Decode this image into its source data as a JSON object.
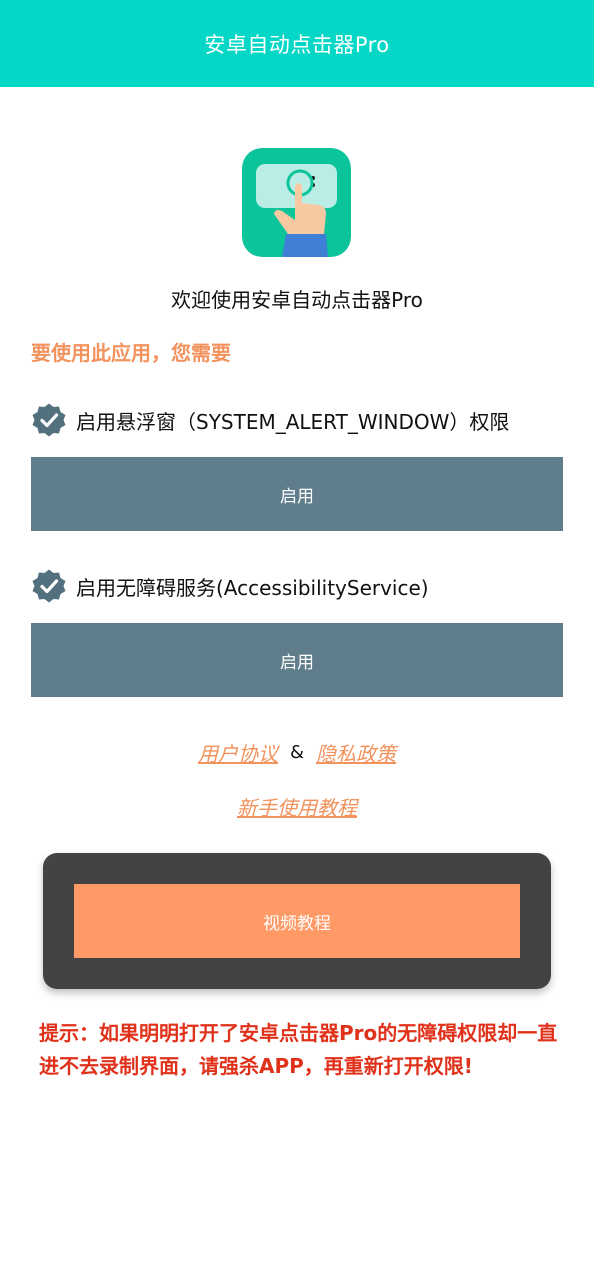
{
  "header": {
    "title": "安卓自动点击器Pro"
  },
  "app_icon": {
    "name": "auto-clicker-app-icon",
    "bg_color": "#0BC49A"
  },
  "welcome_text": "欢迎使用安卓自动点击器Pro",
  "requirement_label": "要使用此应用，您需要",
  "permissions": [
    {
      "label": "启用悬浮窗（SYSTEM_ALERT_WINDOW）权限",
      "button_label": "启用",
      "icon": "check-badge-icon"
    },
    {
      "label": "启用无障碍服务(AccessibilityService)",
      "button_label": "启用",
      "icon": "check-badge-icon"
    }
  ],
  "links": {
    "user_agreement": "用户协议",
    "ampersand": "&",
    "privacy_policy": "隐私政策",
    "beginner_tutorial": "新手使用教程"
  },
  "video_tutorial": {
    "button_label": "视频教程"
  },
  "tip": "提示：如果明明打开了安卓点击器Pro的无障碍权限却一直进不去录制界面，请强杀APP，再重新打开权限!",
  "colors": {
    "header": "#04D7C5",
    "accent_orange": "#F2935D",
    "button_gray": "#607D8B",
    "video_button": "#FF9A66",
    "card_dark": "#434343",
    "tip_red": "#E0311A"
  }
}
